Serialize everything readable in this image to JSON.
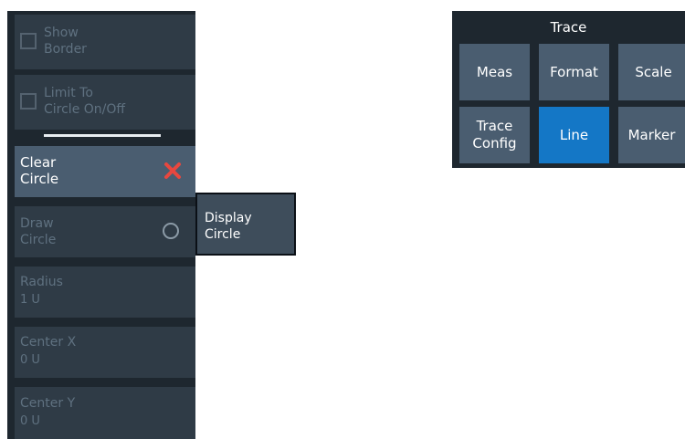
{
  "softkeys": {
    "show_border": "Show\nBorder",
    "limit_to_circle": "Limit To\nCircle On/Off",
    "clear_circle": "Clear\nCircle",
    "draw_circle": "Draw\nCircle",
    "radius": {
      "label": "Radius",
      "value": "1 U"
    },
    "center_x": {
      "label": "Center X",
      "value": "0 U"
    },
    "center_y": {
      "label": "Center Y",
      "value": "0 U"
    }
  },
  "popup": {
    "label": "Display\nCircle"
  },
  "trace_menu": {
    "title": "Trace",
    "buttons": [
      "Meas",
      "Format",
      "Scale",
      "Trace\nConfig",
      "Line",
      "Marker"
    ],
    "selected": "Line"
  },
  "colors": {
    "selected": "#1477c6",
    "clear_icon": "#e8473f",
    "panel": "#1e272f"
  }
}
